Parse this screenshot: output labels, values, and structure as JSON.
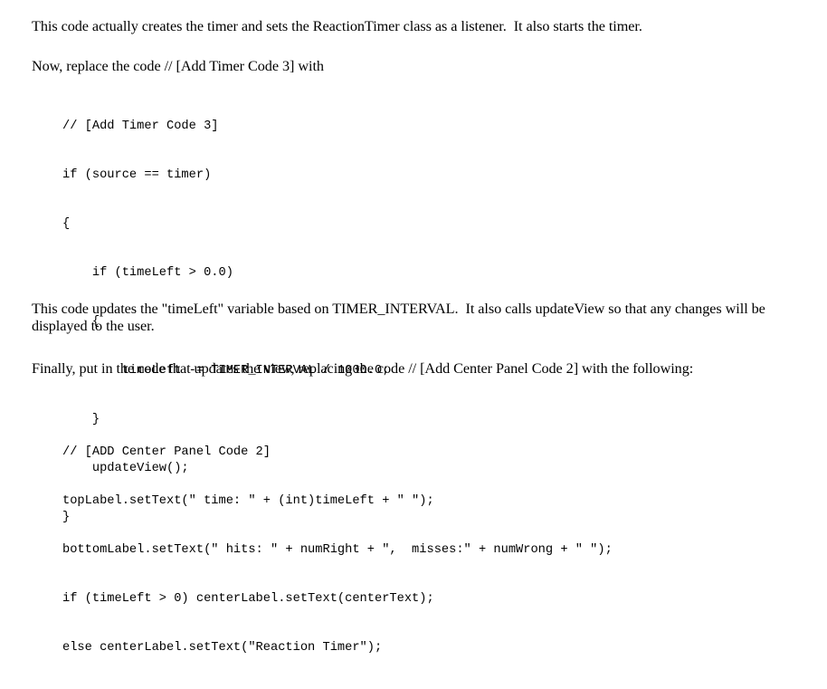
{
  "document": {
    "background_color": "#ffffff",
    "text_color": "#000000",
    "paragraphs": {
      "intro": "This code actually creates the timer and sets the ReactionTimer class as a listener.  It also starts the timer.",
      "now_replace": "Now, replace the code // [Add Timer Code 3] with",
      "updates_explanation": "This code updates the \"timeLeft\" variable based on TIMER_INTERVAL.  It also calls updateView so that any changes will be displayed to the user.",
      "finally_instruction": "Finally, put in the code that updates the view, replacing the code // [Add Center Panel Code 2] with the following:"
    },
    "code_blocks": {
      "timer_code": {
        "lines": [
          "// [Add Timer Code 3]",
          "if (source == timer)",
          "{",
          "    if (timeLeft > 0.0)",
          "    {",
          "        timeLeft -= TIMER_INTERVAL / 1000.0;",
          "    }",
          "    updateView();",
          "}"
        ]
      },
      "center_panel_code": {
        "lines": [
          "// [ADD Center Panel Code 2]",
          "topLabel.setText(\" time: \" + (int)timeLeft + \" \");",
          "bottomLabel.setText(\" hits: \" + numRight + \",  misses:\" + numWrong + \" \");",
          "if (timeLeft > 0) centerLabel.setText(centerText);",
          "else centerLabel.setText(\"Reaction Timer\");"
        ]
      }
    }
  }
}
